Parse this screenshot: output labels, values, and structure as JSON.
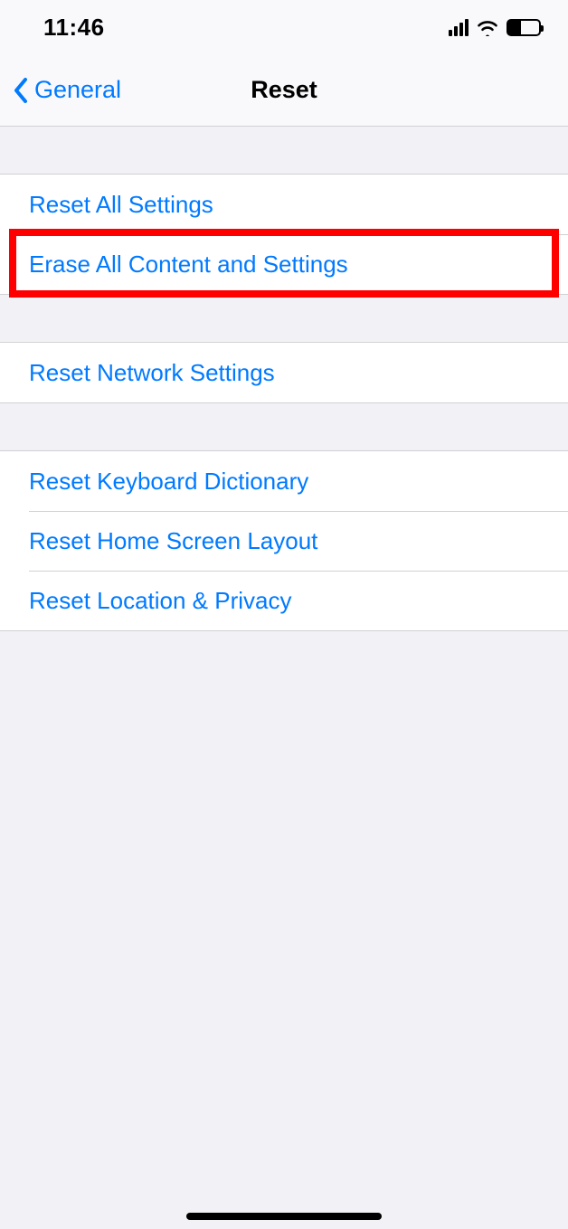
{
  "status": {
    "time": "11:46"
  },
  "nav": {
    "back_label": "General",
    "title": "Reset"
  },
  "sections": [
    {
      "rows": [
        {
          "label": "Reset All Settings",
          "highlight": false
        },
        {
          "label": "Erase All Content and Settings",
          "highlight": true
        }
      ]
    },
    {
      "rows": [
        {
          "label": "Reset Network Settings",
          "highlight": false
        }
      ]
    },
    {
      "rows": [
        {
          "label": "Reset Keyboard Dictionary",
          "highlight": false
        },
        {
          "label": "Reset Home Screen Layout",
          "highlight": false
        },
        {
          "label": "Reset Location & Privacy",
          "highlight": false
        }
      ]
    }
  ]
}
